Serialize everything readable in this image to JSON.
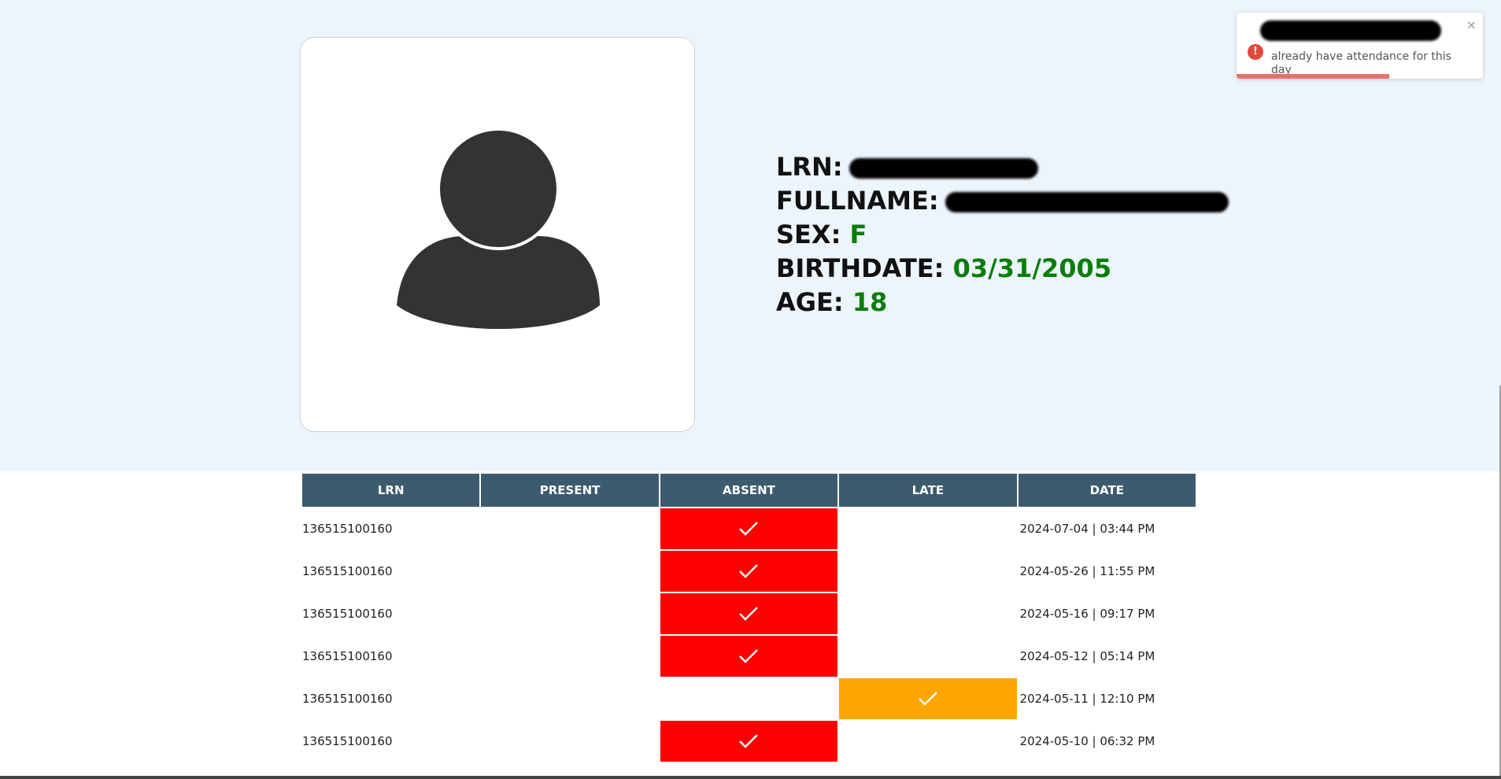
{
  "student": {
    "lrn_label": "LRN:",
    "fullname_label": "FULLNAME:",
    "sex_label": "SEX:",
    "sex_value": "F",
    "birthdate_label": "BIRTHDATE:",
    "birthdate_value": "03/31/2005",
    "age_label": "AGE:",
    "age_value": "18"
  },
  "toast": {
    "message": "already have attendance for this day",
    "close_glyph": "×",
    "icon_glyph": "!",
    "progress": 0.62,
    "type": "error",
    "colors": {
      "icon": "#e04a3b",
      "progress": "#e8726a"
    }
  },
  "table": {
    "headers": [
      "LRN",
      "PRESENT",
      "ABSENT",
      "LATE",
      "DATE"
    ],
    "rows": [
      {
        "lrn": "136515100160",
        "status": "absent",
        "date": "2024-07-04 | 03:44 PM"
      },
      {
        "lrn": "136515100160",
        "status": "absent",
        "date": "2024-05-26 | 11:55 PM"
      },
      {
        "lrn": "136515100160",
        "status": "absent",
        "date": "2024-05-16 | 09:17 PM"
      },
      {
        "lrn": "136515100160",
        "status": "absent",
        "date": "2024-05-12 | 05:14 PM"
      },
      {
        "lrn": "136515100160",
        "status": "late",
        "date": "2024-05-11 | 12:10 PM"
      },
      {
        "lrn": "136515100160",
        "status": "absent",
        "date": "2024-05-10 | 06:32 PM"
      }
    ],
    "colors": {
      "header": "#3d5b6e",
      "absent": "#ff0000",
      "late": "#ffa500",
      "value_green": "#0a7d0a"
    }
  },
  "icons": {
    "avatar": "user-silhouette-icon",
    "check": "checkmark-icon"
  }
}
